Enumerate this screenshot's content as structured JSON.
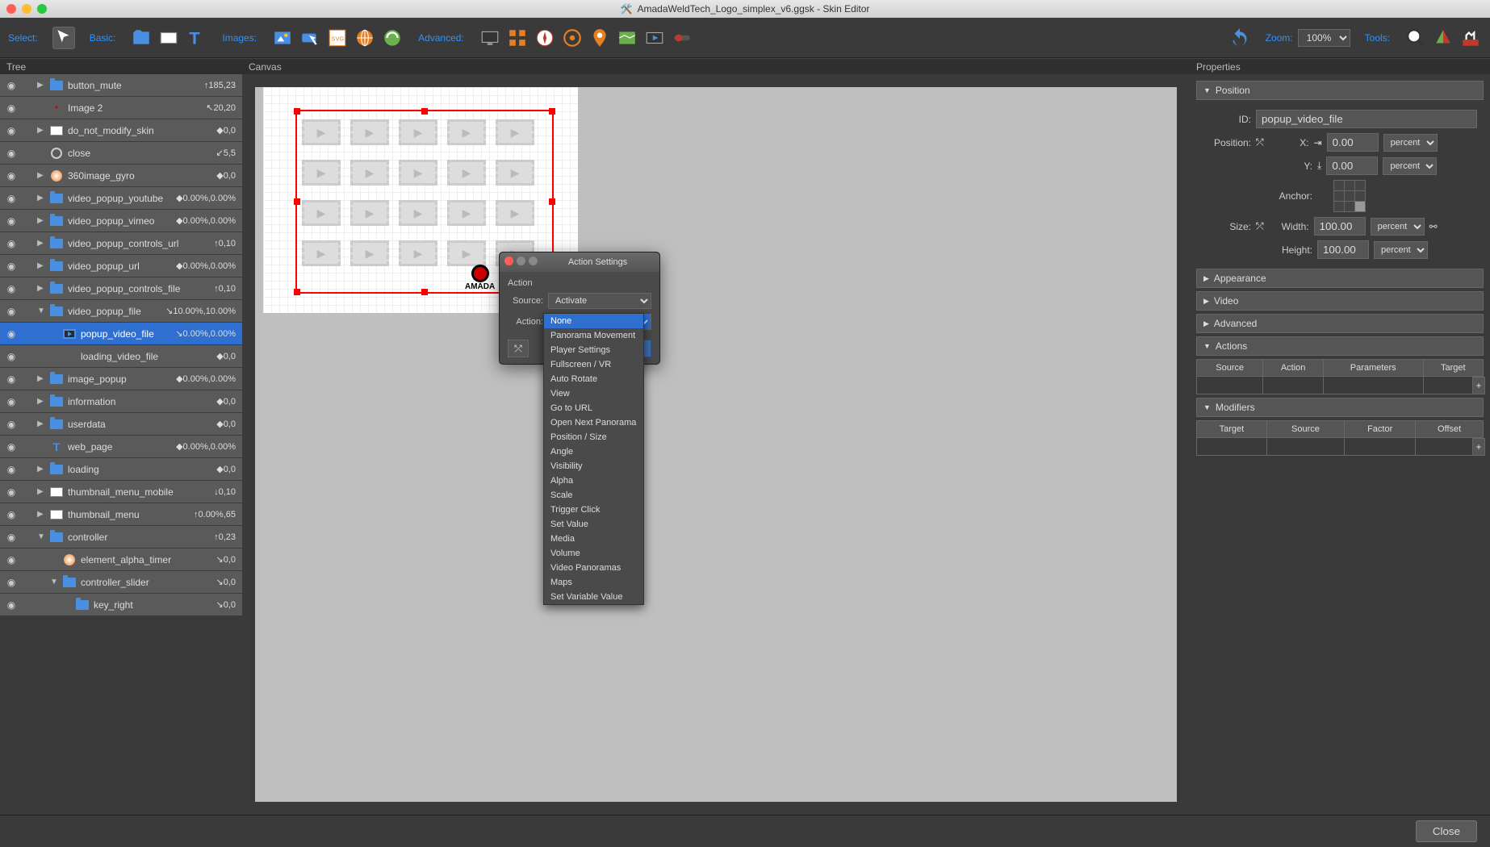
{
  "window": {
    "title": "AmadaWeldTech_Logo_simplex_v6.ggsk - Skin Editor"
  },
  "toolbar": {
    "select_label": "Select:",
    "basic_label": "Basic:",
    "images_label": "Images:",
    "advanced_label": "Advanced:",
    "zoom_label": "Zoom:",
    "zoom_value": "100%",
    "tools_label": "Tools:"
  },
  "panels": {
    "tree": "Tree",
    "canvas": "Canvas",
    "properties": "Properties"
  },
  "tree_items": [
    {
      "label": "button_mute",
      "val": "↑185,23",
      "icon": "folder",
      "disc": "▶",
      "depth": 0
    },
    {
      "label": "Image 2",
      "val": "↖20,20",
      "icon": "amada",
      "disc": "",
      "depth": 0
    },
    {
      "label": "do_not_modify_skin",
      "val": "◆0,0",
      "icon": "rect",
      "disc": "▶",
      "depth": 0
    },
    {
      "label": "close",
      "val": "↙5,5",
      "icon": "ring",
      "disc": "",
      "depth": 0
    },
    {
      "label": "360image_gyro",
      "val": "◆0,0",
      "icon": "disc",
      "disc": "▶",
      "depth": 0
    },
    {
      "label": "video_popup_youtube",
      "val": "◆0.00%,0.00%",
      "icon": "folder",
      "disc": "▶",
      "depth": 0
    },
    {
      "label": "video_popup_vimeo",
      "val": "◆0.00%,0.00%",
      "icon": "folder",
      "disc": "▶",
      "depth": 0
    },
    {
      "label": "video_popup_controls_url",
      "val": "↑0,10",
      "icon": "folder",
      "disc": "▶",
      "depth": 0
    },
    {
      "label": "video_popup_url",
      "val": "◆0.00%,0.00%",
      "icon": "folder",
      "disc": "▶",
      "depth": 0
    },
    {
      "label": "video_popup_controls_file",
      "val": "↑0,10",
      "icon": "folder",
      "disc": "▶",
      "depth": 0
    },
    {
      "label": "video_popup_file",
      "val": "↘10.00%,10.00%",
      "icon": "folder",
      "disc": "▼",
      "depth": 0
    },
    {
      "label": "popup_video_file",
      "val": "↘0.00%,0.00%",
      "icon": "video",
      "disc": "",
      "depth": 1,
      "selected": true
    },
    {
      "label": "loading_video_file",
      "val": "◆0,0",
      "icon": "none",
      "disc": "",
      "depth": 1
    },
    {
      "label": "image_popup",
      "val": "◆0.00%,0.00%",
      "icon": "folder",
      "disc": "▶",
      "depth": 0
    },
    {
      "label": "information",
      "val": "◆0,0",
      "icon": "folder",
      "disc": "▶",
      "depth": 0
    },
    {
      "label": "userdata",
      "val": "◆0,0",
      "icon": "folder",
      "disc": "▶",
      "depth": 0
    },
    {
      "label": "web_page",
      "val": "◆0.00%,0.00%",
      "icon": "text",
      "disc": "",
      "depth": 0
    },
    {
      "label": "loading",
      "val": "◆0,0",
      "icon": "folder",
      "disc": "▶",
      "depth": 0
    },
    {
      "label": "thumbnail_menu_mobile",
      "val": "↓0,10",
      "icon": "rect",
      "disc": "▶",
      "depth": 0
    },
    {
      "label": "thumbnail_menu",
      "val": "↑0.00%,65",
      "icon": "rect",
      "disc": "▶",
      "depth": 0
    },
    {
      "label": "controller",
      "val": "↑0,23",
      "icon": "folder",
      "disc": "▼",
      "depth": 0
    },
    {
      "label": "element_alpha_timer",
      "val": "↘0,0",
      "icon": "disc",
      "disc": "",
      "depth": 1
    },
    {
      "label": "controller_slider",
      "val": "↘0,0",
      "icon": "folder",
      "disc": "▼",
      "depth": 1
    },
    {
      "label": "key_right",
      "val": "↘0,0",
      "icon": "folder",
      "disc": "",
      "depth": 2
    }
  ],
  "canvas_text": "AMADA",
  "popup": {
    "title": "Action Settings",
    "action_header": "Action",
    "source_label": "Source:",
    "source_value": "Activate",
    "action_label": "Action:"
  },
  "dropdown_items": [
    "None",
    "Panorama Movement",
    "Player Settings",
    "Fullscreen / VR",
    "Auto Rotate",
    "View",
    "Go to URL",
    "Open Next Panorama",
    "Position / Size",
    "Angle",
    "Visibility",
    "Alpha",
    "Scale",
    "Trigger Click",
    "Set Value",
    "Media",
    "Volume",
    "Video Panoramas",
    "Maps",
    "Set Variable Value"
  ],
  "props": {
    "position_section": "Position",
    "appearance_section": "Appearance",
    "video_section": "Video",
    "advanced_section": "Advanced",
    "actions_section": "Actions",
    "modifiers_section": "Modifiers",
    "id_label": "ID:",
    "id_value": "popup_video_file",
    "position_label": "Position:",
    "x_label": "X:",
    "x_value": "0.00",
    "y_label": "Y:",
    "y_value": "0.00",
    "anchor_label": "Anchor:",
    "size_label": "Size:",
    "width_label": "Width:",
    "width_value": "100.00",
    "height_label": "Height:",
    "height_value": "100.00",
    "unit_percent": "percent",
    "actions_table": {
      "c1": "Source",
      "c2": "Action",
      "c3": "Parameters",
      "c4": "Target"
    },
    "modifiers_table": {
      "c1": "Target",
      "c2": "Source",
      "c3": "Factor",
      "c4": "Offset"
    }
  },
  "footer": {
    "close": "Close"
  }
}
